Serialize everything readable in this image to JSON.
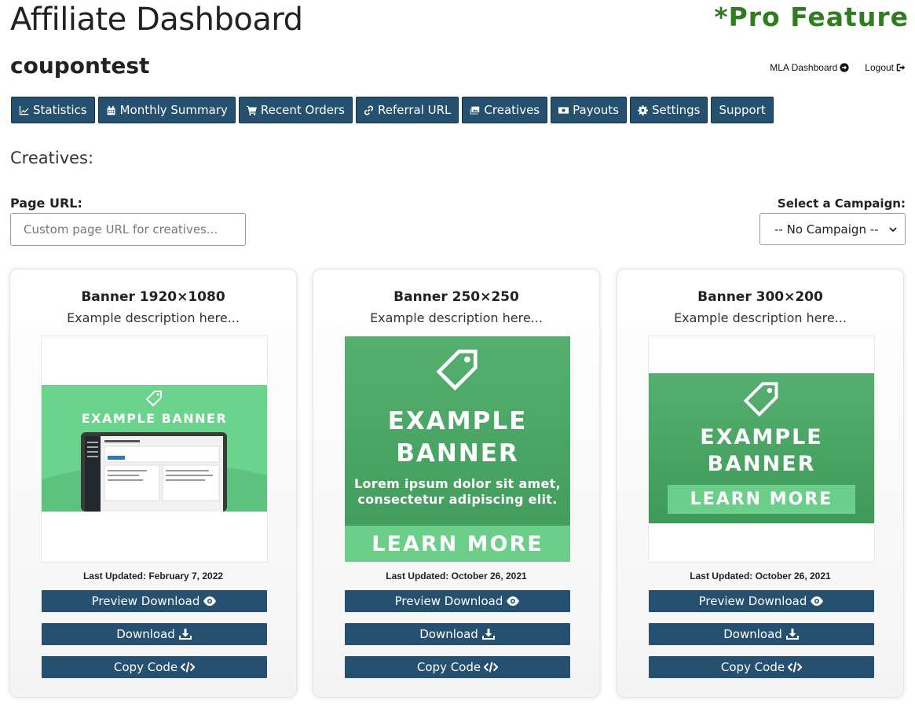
{
  "header": {
    "title": "Affiliate Dashboard",
    "pro_feature": "*Pro Feature",
    "username": "coupontest",
    "links": {
      "mla_dashboard": "MLA Dashboard",
      "logout": "Logout"
    }
  },
  "nav": {
    "items": [
      {
        "label": "Statistics",
        "icon": "line-chart-icon"
      },
      {
        "label": "Monthly Summary",
        "icon": "calendar-icon"
      },
      {
        "label": "Recent Orders",
        "icon": "cart-icon"
      },
      {
        "label": "Referral URL",
        "icon": "link-icon"
      },
      {
        "label": "Creatives",
        "icon": "images-icon"
      },
      {
        "label": "Payouts",
        "icon": "money-icon"
      },
      {
        "label": "Settings",
        "icon": "gear-icon"
      },
      {
        "label": "Support",
        "icon": ""
      }
    ]
  },
  "creatives": {
    "heading": "Creatives:",
    "page_url_label": "Page URL:",
    "page_url_placeholder": "Custom page URL for creatives...",
    "campaign_label": "Select a Campaign:",
    "campaign_selected": "-- No Campaign --"
  },
  "cards": [
    {
      "title": "Banner 1920×1080",
      "description": "Example description here...",
      "updated_label": "Last Updated:",
      "updated_date": "February 7, 2022",
      "banner_text": "EXAMPLE BANNER"
    },
    {
      "title": "Banner 250×250",
      "description": "Example description here...",
      "updated_label": "Last Updated:",
      "updated_date": "October 26, 2021",
      "banner_line1": "EXAMPLE",
      "banner_line2": "BANNER",
      "banner_sub1": "Lorem ipsum dolor sit amet,",
      "banner_sub2": "consectetur adipiscing elit.",
      "banner_cta": "LEARN MORE"
    },
    {
      "title": "Banner 300×200",
      "description": "Example description here...",
      "updated_label": "Last Updated:",
      "updated_date": "October 26, 2021",
      "banner_line1": "EXAMPLE",
      "banner_line2": "BANNER",
      "banner_cta": "LEARN MORE"
    }
  ],
  "buttons": {
    "preview_download": "Preview Download",
    "download": "Download",
    "copy_code": "Copy Code"
  },
  "colors": {
    "button_bg": "#25506f",
    "pro_feature": "#2e7d1e",
    "banner_green": "#52ad6a",
    "banner_light_green": "#6bcf8a"
  }
}
